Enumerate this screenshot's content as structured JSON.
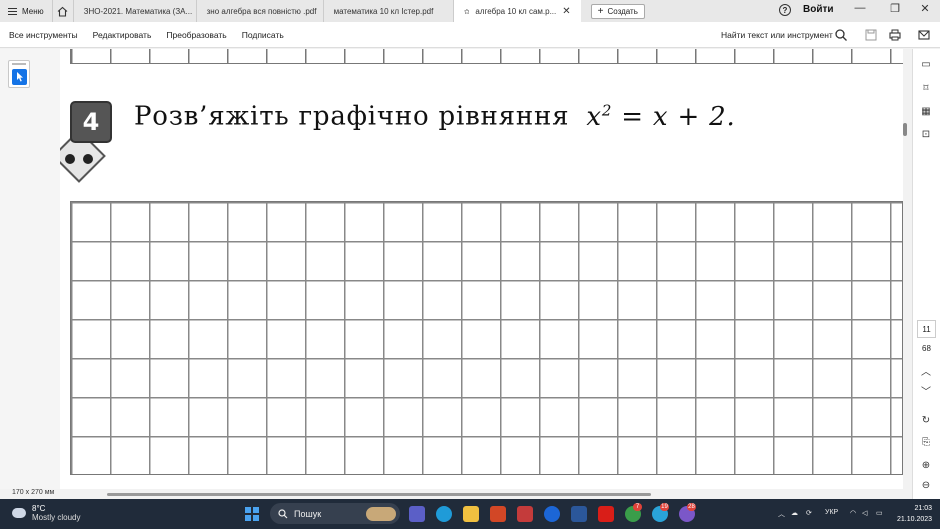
{
  "tabbar": {
    "menu_label": "Меню",
    "tabs": [
      {
        "label": "ЗНО-2021. Математика (ЗА..."
      },
      {
        "label": "зно алгебра вся повністю .pdf"
      },
      {
        "label": "математика 10 кл Істер.pdf"
      },
      {
        "label": "алгебра 10 кл сам.р..."
      }
    ],
    "create_label": "Создать",
    "help_glyph": "?",
    "login_label": "Войти",
    "win_min": "—",
    "win_max": "❐",
    "win_close": "✕"
  },
  "toolbar": {
    "items": [
      {
        "label": "Все инструменты"
      },
      {
        "label": "Редактировать"
      },
      {
        "label": "Преобразовать"
      },
      {
        "label": "Подписать"
      }
    ],
    "search_label": "Найти текст или инструмент"
  },
  "document": {
    "task_number": "4",
    "task_text": "Розв’яжіть графічно рівняння",
    "equation_base": "x",
    "equation_exp": "2",
    "equation_rest": " = x + 2."
  },
  "right_panel": {
    "current_page": "11",
    "total_pages": "68"
  },
  "statusbar": {
    "page_size": "170 x 270 мм"
  },
  "taskbar": {
    "temperature": "8°C",
    "weather": "Mostly cloudy",
    "search_label": "Пошук",
    "badges": [
      "7",
      "19",
      "28"
    ],
    "language": "УКР",
    "time": "21:03",
    "date": "21.10.2023"
  }
}
